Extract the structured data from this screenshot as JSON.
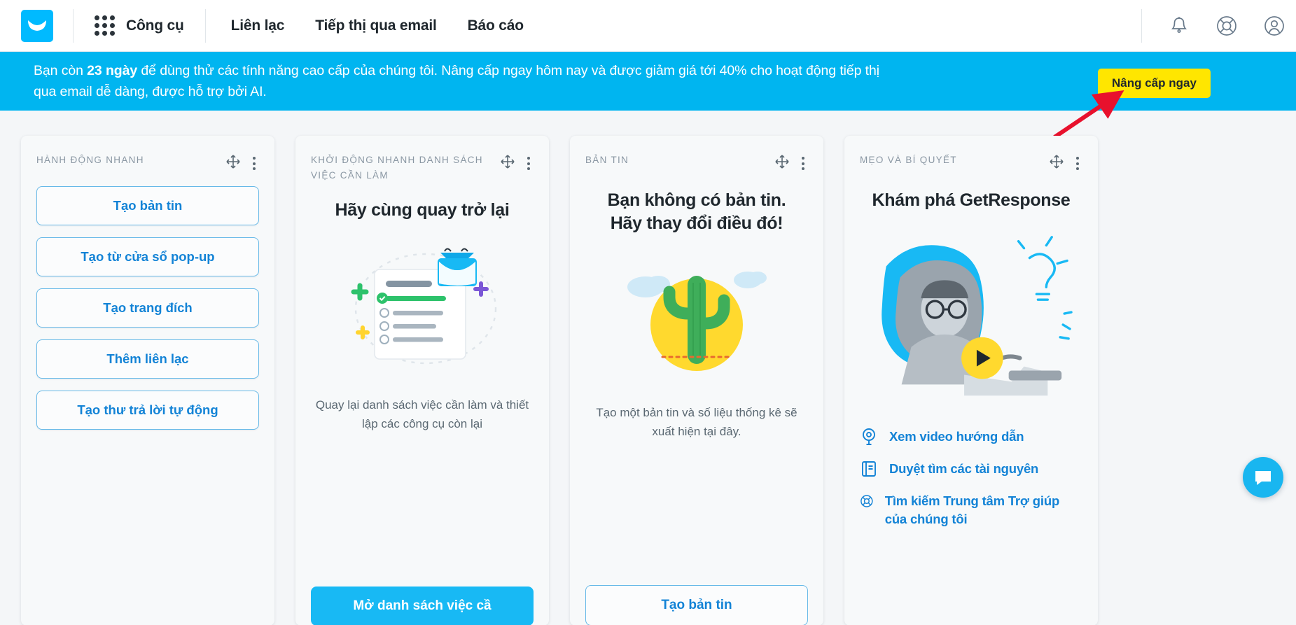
{
  "header": {
    "logo_icon": "getresponse-envelope-logo",
    "apps_icon": "grid-apps-icon",
    "tools_label": "Công cụ",
    "nav": [
      {
        "label": "Liên lạc",
        "name": "nav-contacts"
      },
      {
        "label": "Tiếp thị qua email",
        "name": "nav-email-marketing"
      },
      {
        "label": "Báo cáo",
        "name": "nav-reports"
      }
    ],
    "icons": [
      {
        "name": "notification-bell-icon"
      },
      {
        "name": "help-lifebuoy-icon"
      },
      {
        "name": "account-avatar-icon"
      }
    ]
  },
  "banner": {
    "text_before": "Bạn còn ",
    "days_bold": "23 ngày",
    "text_after": " để dùng thử các tính năng cao cấp của chúng tôi. Nâng cấp ngay hôm nay và được giảm giá tới 40% cho hoạt động tiếp thị qua email dễ dàng, được hỗ trợ bởi AI.",
    "upgrade_label": "Nâng cấp ngay",
    "bg_color": "#00b5f0",
    "button_color": "#ffe600",
    "arrow_color": "#e8112d"
  },
  "cards": {
    "quick_actions": {
      "eyebrow": "HÀNH ĐỘNG NHANH",
      "buttons": [
        "Tạo bản tin",
        "Tạo từ cửa sổ pop-up",
        "Tạo trang đích",
        "Thêm liên lạc",
        "Tạo thư trả lời tự động"
      ]
    },
    "quickstart": {
      "eyebrow": "KHỞI ĐỘNG NHANH DANH SÁCH VIỆC CẦN LÀM",
      "title": "Hãy cùng quay trở lại",
      "description": "Quay lại danh sách việc cần làm và thiết lập các công cụ còn lại",
      "cta": "Mở danh sách việc cầ"
    },
    "newsletter": {
      "eyebrow": "BẢN TIN",
      "title_line1": "Bạn không có bản tin.",
      "title_line2": "Hãy thay đổi điều đó!",
      "description": "Tạo một bản tin và số liệu thống kê sẽ xuất hiện tại đây.",
      "cta": "Tạo bản tin"
    },
    "tips": {
      "eyebrow": "MẸO VÀ BÍ QUYẾT",
      "title": "Khám phá GetResponse",
      "play_icon": "play-button-icon",
      "links": [
        {
          "label": "Xem video hướng dẫn",
          "icon": "video-target-icon"
        },
        {
          "label": "Duyệt tìm các tài nguyên",
          "icon": "book-resources-icon"
        },
        {
          "label": "Tìm kiếm Trung tâm Trợ giúp của chúng tôi",
          "icon": "lifebuoy-help-icon"
        }
      ]
    }
  },
  "chat_widget": {
    "icon": "chat-bubble-icon",
    "color": "#19b6f0"
  }
}
